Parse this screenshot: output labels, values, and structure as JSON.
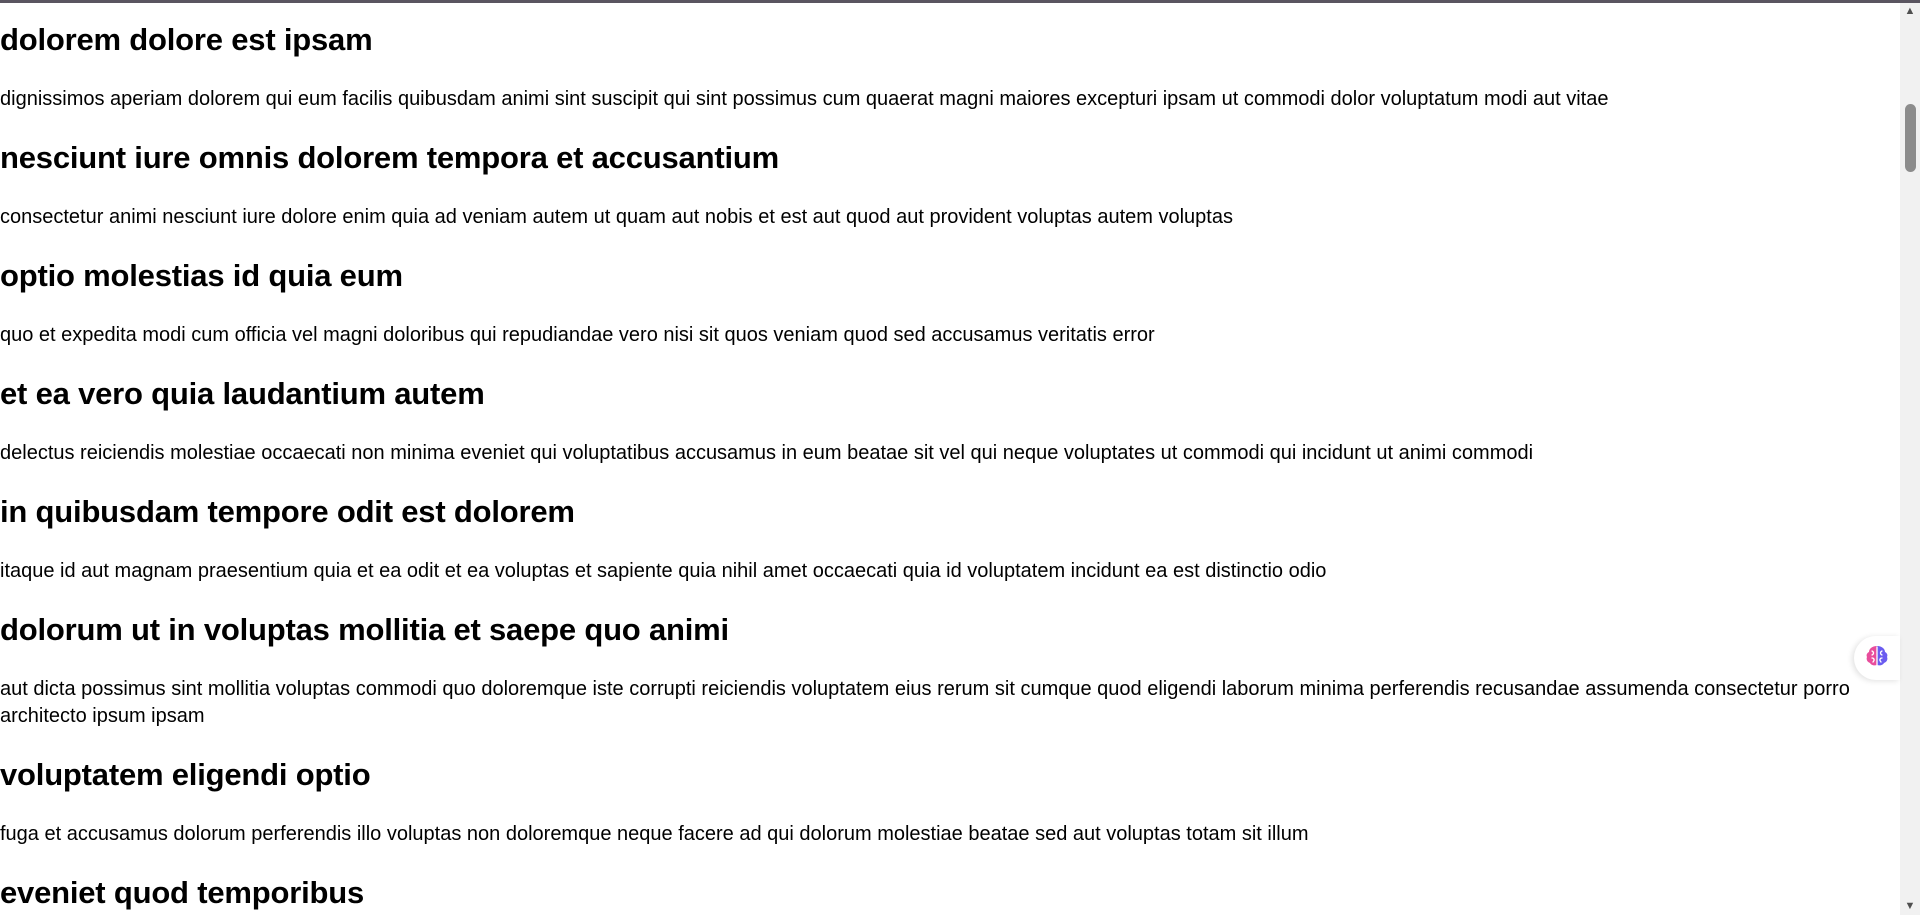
{
  "sections": [
    {
      "title": "dolorem dolore est ipsam",
      "body": "dignissimos aperiam dolorem qui eum facilis quibusdam animi sint suscipit qui sint possimus cum quaerat magni maiores excepturi ipsam ut commodi dolor voluptatum modi aut vitae"
    },
    {
      "title": "nesciunt iure omnis dolorem tempora et accusantium",
      "body": "consectetur animi nesciunt iure dolore enim quia ad veniam autem ut quam aut nobis et est aut quod aut provident voluptas autem voluptas"
    },
    {
      "title": "optio molestias id quia eum",
      "body": "quo et expedita modi cum officia vel magni doloribus qui repudiandae vero nisi sit quos veniam quod sed accusamus veritatis error"
    },
    {
      "title": "et ea vero quia laudantium autem",
      "body": "delectus reiciendis molestiae occaecati non minima eveniet qui voluptatibus accusamus in eum beatae sit vel qui neque voluptates ut commodi qui incidunt ut animi commodi"
    },
    {
      "title": "in quibusdam tempore odit est dolorem",
      "body": "itaque id aut magnam praesentium quia et ea odit et ea voluptas et sapiente quia nihil amet occaecati quia id voluptatem incidunt ea est distinctio odio"
    },
    {
      "title": "dolorum ut in voluptas mollitia et saepe quo animi",
      "body": "aut dicta possimus sint mollitia voluptas commodi quo doloremque iste corrupti reiciendis voluptatem eius rerum sit cumque quod eligendi laborum minima perferendis recusandae assumenda consectetur porro architecto ipsum ipsam"
    },
    {
      "title": "voluptatem eligendi optio",
      "body": "fuga et accusamus dolorum perferendis illo voluptas non doloremque neque facere ad qui dolorum molestiae beatae sed aut voluptas totam sit illum"
    },
    {
      "title": "eveniet quod temporibus",
      "body": ""
    }
  ],
  "scrollbar": {
    "up_arrow": "▲",
    "down_arrow": "▼",
    "position_fraction": 0.05
  },
  "floating_widget": {
    "icon": "brain-icon"
  },
  "colors": {
    "top_border": "#5a5560",
    "text": "#000000",
    "background": "#ffffff",
    "widget_brain_left": "#e84d9c",
    "widget_brain_right": "#6a5cf0"
  }
}
